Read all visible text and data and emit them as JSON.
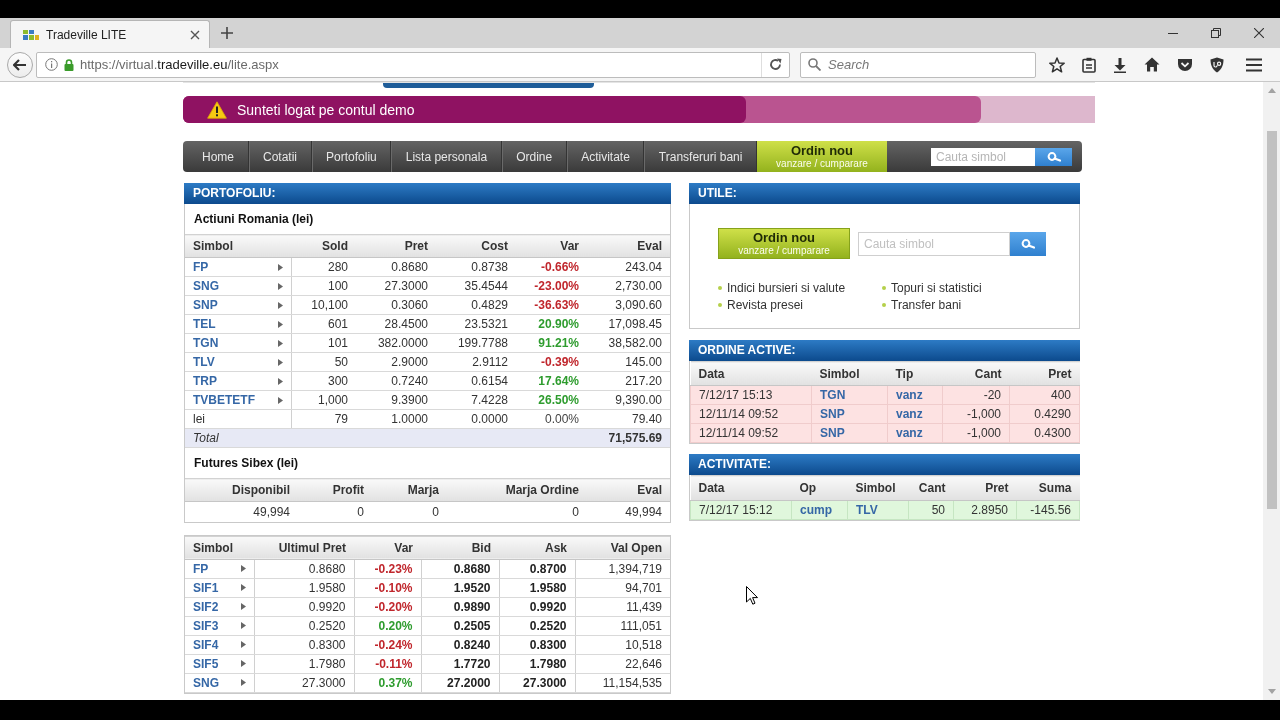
{
  "browser": {
    "tab": {
      "title": "Tradeville LITE"
    },
    "address": "https://virtual.**tradeville.eu**/lite.aspx",
    "search": {
      "placeholder": "Search"
    }
  },
  "banner": {
    "message": "Sunteti logat pe contul demo"
  },
  "nav": {
    "items": [
      {
        "label": "Home",
        "selected": false
      },
      {
        "label": "Cotatii",
        "selected": false
      },
      {
        "label": "Portofoliu",
        "selected": false
      },
      {
        "label": "Lista personala",
        "selected": false
      },
      {
        "label": "Ordine",
        "selected": false
      },
      {
        "label": "Activitate",
        "selected": false
      },
      {
        "label": "Transferuri bani",
        "selected": false
      }
    ],
    "order_button": {
      "title": "Ordin nou",
      "subtitle": "vanzare / cumparare"
    },
    "search": {
      "placeholder": "Cauta simbol"
    }
  },
  "portfolio": {
    "title": "PORTOFOLIU:",
    "stocks": {
      "heading": "Actiuni Romania (lei)",
      "columns": [
        "Simbol",
        "Sold",
        "Pret",
        "Cost",
        "Var",
        "Eval"
      ],
      "rows": [
        {
          "symbol": "FP",
          "kind": "security",
          "sold": "280",
          "price": "0.8680",
          "cost": "0.8738",
          "var": {
            "text": "-0.66%",
            "color": "#c0262c"
          },
          "eval": "243.04"
        },
        {
          "symbol": "SNG",
          "kind": "security",
          "sold": "100",
          "price": "27.3000",
          "cost": "35.4544",
          "var": {
            "text": "-23.00%",
            "color": "#c0262c"
          },
          "eval": "2,730.00"
        },
        {
          "symbol": "SNP",
          "kind": "security",
          "sold": "10,100",
          "price": "0.3060",
          "cost": "0.4829",
          "var": {
            "text": "-36.63%",
            "color": "#c0262c"
          },
          "eval": "3,090.60"
        },
        {
          "symbol": "TEL",
          "kind": "security",
          "sold": "601",
          "price": "28.4500",
          "cost": "23.5321",
          "var": {
            "text": "20.90%",
            "color": "#2e9c2e"
          },
          "eval": "17,098.45"
        },
        {
          "symbol": "TGN",
          "kind": "security",
          "sold": "101",
          "price": "382.0000",
          "cost": "199.7788",
          "var": {
            "text": "91.21%",
            "color": "#2e9c2e"
          },
          "eval": "38,582.00"
        },
        {
          "symbol": "TLV",
          "kind": "security",
          "sold": "50",
          "price": "2.9000",
          "cost": "2.9112",
          "var": {
            "text": "-0.39%",
            "color": "#c0262c"
          },
          "eval": "145.00"
        },
        {
          "symbol": "TRP",
          "kind": "security",
          "sold": "300",
          "price": "0.7240",
          "cost": "0.6154",
          "var": {
            "text": "17.64%",
            "color": "#2e9c2e"
          },
          "eval": "217.20"
        },
        {
          "symbol": "TVBETETF",
          "kind": "security",
          "sold": "1,000",
          "price": "9.3900",
          "cost": "7.4228",
          "var": {
            "text": "26.50%",
            "color": "#2e9c2e"
          },
          "eval": "9,390.00"
        },
        {
          "symbol": "lei",
          "kind": "cash",
          "sold": "79",
          "price": "1.0000",
          "cost": "0.0000",
          "var": {
            "text": "0.00%",
            "color": "#444444"
          },
          "eval": "79.40"
        }
      ],
      "total": {
        "label": "Total",
        "value": "71,575.69"
      }
    },
    "futures": {
      "heading": "Futures Sibex (lei)",
      "columns": [
        "Disponibil",
        "Profit",
        "Marja",
        "Marja Ordine",
        "Eval"
      ],
      "values": [
        "49,994",
        "0",
        "0",
        "0",
        "49,994"
      ]
    }
  },
  "quotes": {
    "columns": [
      "Simbol",
      "Ultimul Pret",
      "Var",
      "Bid",
      "Ask",
      "Val Open"
    ],
    "rows": [
      {
        "symbol": "FP",
        "last": "0.8680",
        "var": {
          "text": "-0.23%",
          "color": "#c0262c"
        },
        "bid": "0.8680",
        "ask": "0.8700",
        "val_open": "1,394,719"
      },
      {
        "symbol": "SIF1",
        "last": "1.9580",
        "var": {
          "text": "-0.10%",
          "color": "#c0262c"
        },
        "bid": "1.9520",
        "ask": "1.9580",
        "val_open": "94,701"
      },
      {
        "symbol": "SIF2",
        "last": "0.9920",
        "var": {
          "text": "-0.20%",
          "color": "#c0262c"
        },
        "bid": "0.9890",
        "ask": "0.9920",
        "val_open": "11,439"
      },
      {
        "symbol": "SIF3",
        "last": "0.2520",
        "var": {
          "text": "0.20%",
          "color": "#2e9c2e"
        },
        "bid": "0.2505",
        "ask": "0.2520",
        "val_open": "111,051"
      },
      {
        "symbol": "SIF4",
        "last": "0.8300",
        "var": {
          "text": "-0.24%",
          "color": "#c0262c"
        },
        "bid": "0.8240",
        "ask": "0.8300",
        "val_open": "10,518"
      },
      {
        "symbol": "SIF5",
        "last": "1.7980",
        "var": {
          "text": "-0.11%",
          "color": "#c0262c"
        },
        "bid": "1.7720",
        "ask": "1.7980",
        "val_open": "22,646"
      },
      {
        "symbol": "SNG",
        "last": "27.3000",
        "var": {
          "text": "0.37%",
          "color": "#2e9c2e"
        },
        "bid": "27.2000",
        "ask": "27.3000",
        "val_open": "11,154,535"
      }
    ]
  },
  "utile": {
    "title": "UTILE:",
    "order_button": {
      "title": "Ordin nou",
      "subtitle": "vanzare / cumparare"
    },
    "search": {
      "placeholder": "Cauta simbol"
    },
    "links": [
      "Indici bursieri si valute",
      "Topuri si statistici",
      "Revista presei",
      "Transfer bani"
    ]
  },
  "active_orders": {
    "title": "ORDINE ACTIVE:",
    "columns": [
      "Data",
      "Simbol",
      "Tip",
      "Cant",
      "Pret"
    ],
    "rows": [
      {
        "kind": "sell",
        "date": "7/12/17 15:13",
        "symbol": "TGN",
        "type": "vanz",
        "qty": "-20",
        "price": "400"
      },
      {
        "kind": "sell",
        "date": "12/11/14 09:52",
        "symbol": "SNP",
        "type": "vanz",
        "qty": "-1,000",
        "price": "0.4290"
      },
      {
        "kind": "sell",
        "date": "12/11/14 09:52",
        "symbol": "SNP",
        "type": "vanz",
        "qty": "-1,000",
        "price": "0.4300"
      }
    ]
  },
  "activity": {
    "title": "ACTIVITATE:",
    "columns": [
      "Data",
      "Op",
      "Simbol",
      "Cant",
      "Pret",
      "Suma"
    ],
    "rows": [
      {
        "kind": "buy",
        "date": "7/12/17 15:12",
        "op": "cump",
        "symbol": "TLV",
        "qty": "50",
        "price": "2.8950",
        "sum": "-145.56"
      }
    ]
  }
}
